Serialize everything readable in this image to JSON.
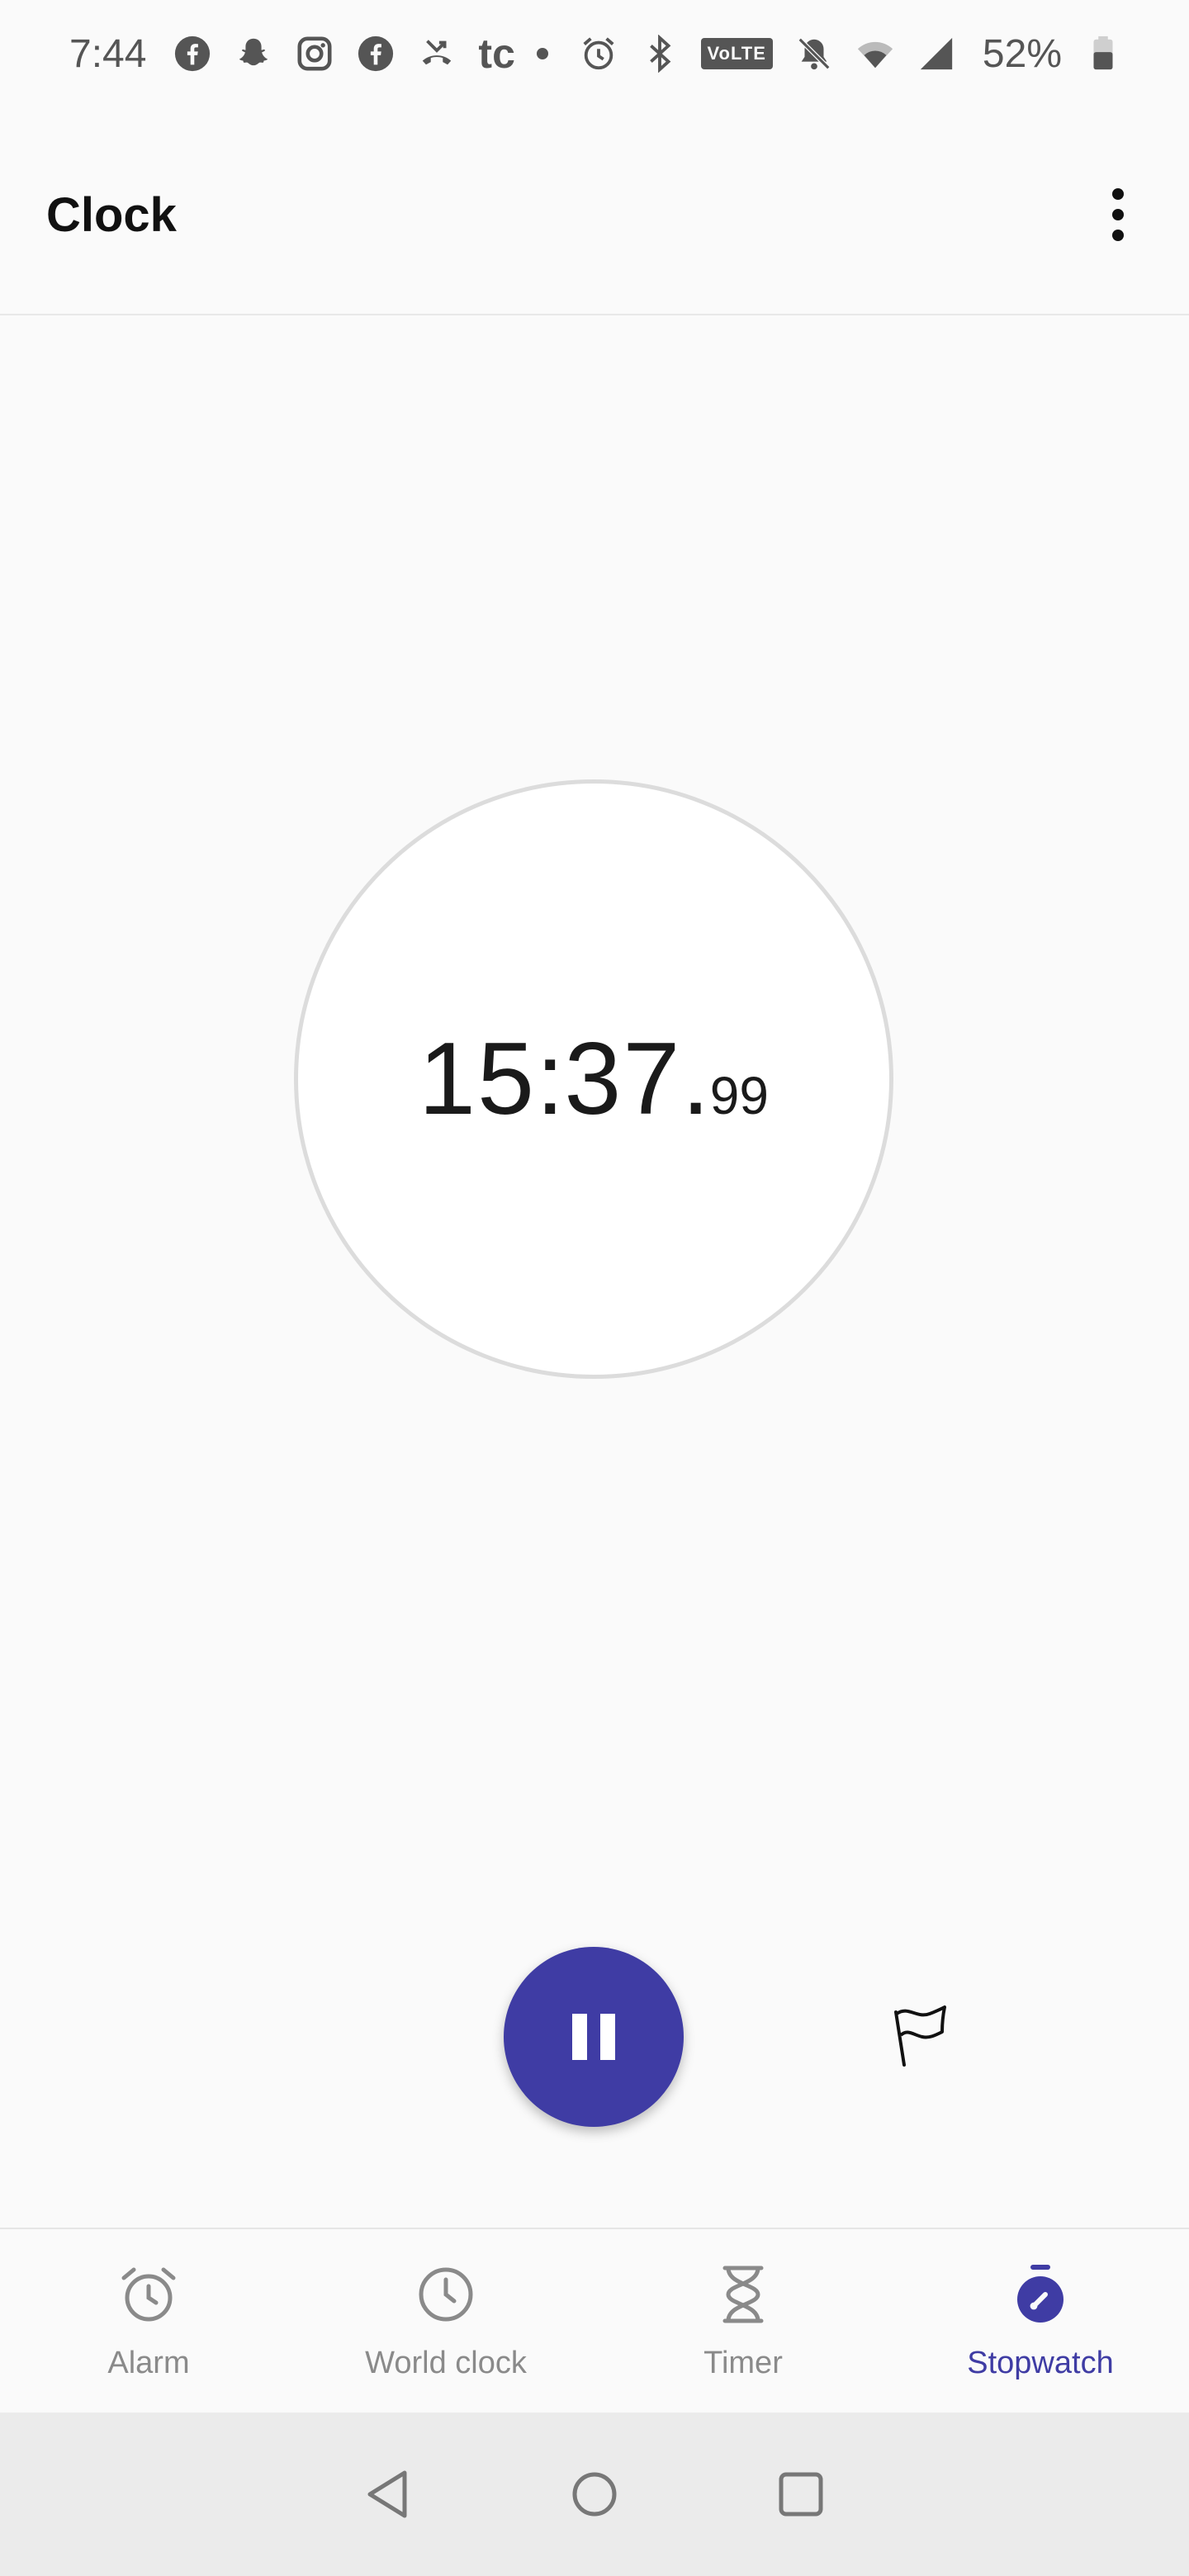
{
  "status_bar": {
    "time": "7:44",
    "left_icons": [
      "facebook-icon",
      "snapchat-icon",
      "instagram-icon",
      "facebook-icon",
      "missed-call-icon",
      "tc-icon",
      "dot-icon"
    ],
    "tc_label": "tc",
    "volte_label": "VoLTE",
    "battery_percent": "52%"
  },
  "app_bar": {
    "title": "Clock"
  },
  "stopwatch": {
    "minutes": "15",
    "seconds": "37",
    "centiseconds": "99",
    "separator": ":",
    "decimal": "."
  },
  "bottom_nav": {
    "items": [
      {
        "label": "Alarm",
        "icon": "alarm-icon",
        "active": false
      },
      {
        "label": "World clock",
        "icon": "clock-icon",
        "active": false
      },
      {
        "label": "Timer",
        "icon": "hourglass-icon",
        "active": false
      },
      {
        "label": "Stopwatch",
        "icon": "stopwatch-icon",
        "active": true
      }
    ]
  },
  "colors": {
    "accent": "#3f3ca4",
    "background": "#fafafa",
    "dial_border": "#dcdcdc",
    "inactive": "#8a8a8a"
  }
}
